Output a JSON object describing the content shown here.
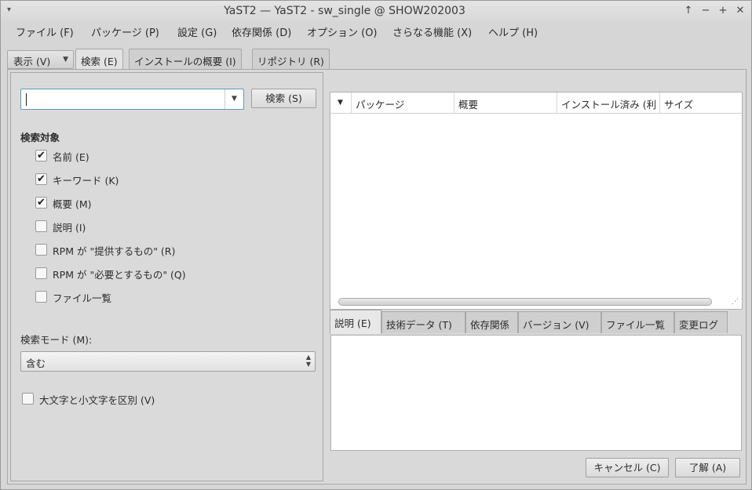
{
  "window": {
    "title": "YaST2 — YaST2 - sw_single @ SHOW202003",
    "menu_icon": "▾",
    "controls": {
      "up": "↑",
      "minimize": "−",
      "maximize": "+",
      "close": "✕"
    }
  },
  "menubar": [
    "ファイル (F)",
    "パッケージ (P)",
    "設定 (G)",
    "依存関係 (D)",
    "オプション (O)",
    "さらなる機能 (X)",
    "ヘルプ (H)"
  ],
  "top_tabs": {
    "view_combo": "表示 (V)",
    "tabs": [
      "検索 (E)",
      "インストールの概要 (I)",
      "リポジトリ (R)"
    ]
  },
  "search": {
    "value": "",
    "button": "検索 (S)",
    "target_label": "検索対象",
    "targets": [
      {
        "label": "名前 (E)",
        "checked": true
      },
      {
        "label": "キーワード (K)",
        "checked": true
      },
      {
        "label": "概要 (M)",
        "checked": true
      },
      {
        "label": "説明 (I)",
        "checked": false
      },
      {
        "label": "RPM が \"提供するもの\" (R)",
        "checked": false
      },
      {
        "label": "RPM が \"必要とするもの\" (Q)",
        "checked": false
      },
      {
        "label": "ファイル一覧",
        "checked": false
      }
    ],
    "mode_label": "検索モード (M):",
    "mode_value": "含む",
    "case_label": "大文字と小文字を区別 (V)",
    "case_checked": false
  },
  "package_table": {
    "columns": [
      "パッケージ",
      "概要",
      "インストール済み (利",
      "サイズ"
    ]
  },
  "detail_tabs": [
    "説明 (E)",
    "技術データ (T)",
    "依存関係",
    "バージョン (V)",
    "ファイル一覧",
    "変更ログ"
  ],
  "buttons": {
    "cancel": "キャンセル (C)",
    "ok": "了解 (A)"
  },
  "icons": {
    "dropdown": "▼",
    "check": "✔",
    "spin_up": "▲",
    "spin_down": "▼"
  }
}
